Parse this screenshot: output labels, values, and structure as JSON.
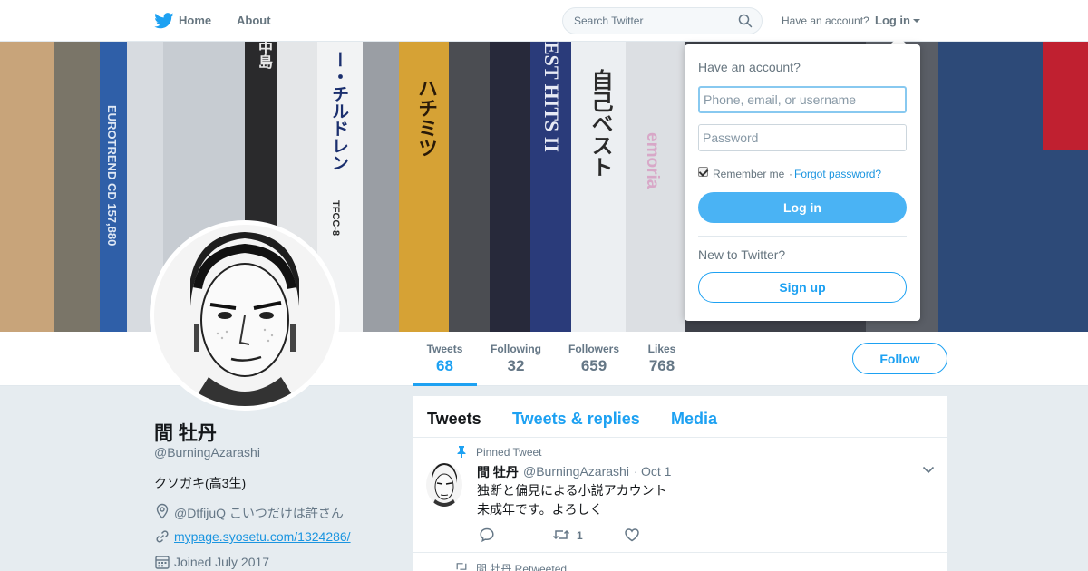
{
  "nav": {
    "home_label": "Home",
    "about_label": "About",
    "search_placeholder": "Search Twitter",
    "have_account": "Have an account?",
    "login_label": "Log in"
  },
  "banner": {
    "spine_texts": [
      "EUROTREND CD 157,880",
      "ー・チルドレン",
      "TFCC-8",
      "ハチミツ",
      "EST HITS II",
      "自己ベスト",
      "emoria",
      "中島"
    ]
  },
  "stats": [
    {
      "label": "Tweets",
      "value": "68"
    },
    {
      "label": "Following",
      "value": "32"
    },
    {
      "label": "Followers",
      "value": "659"
    },
    {
      "label": "Likes",
      "value": "768"
    }
  ],
  "follow_label": "Follow",
  "profile": {
    "name": "間 牡丹",
    "handle": "@BurningAzarashi",
    "bio": "クソガキ(高3生)",
    "location": "@DtfijuQ こいつだけは許さん",
    "url": "mypage.syosetu.com/1324286/",
    "joined": "Joined July 2017"
  },
  "timeline": {
    "tabs": [
      "Tweets",
      "Tweets & replies",
      "Media"
    ],
    "pinned_label": "Pinned Tweet",
    "tweet": {
      "name": "間 牡丹",
      "handle": "@BurningAzarashi",
      "separator": "·",
      "date": "Oct 1",
      "lines": [
        "独断と偏見による小説アカウント",
        "未成年です。よろしく"
      ],
      "retweet_count": "1"
    },
    "retweeted_label": "間 牡丹 Retweeted"
  },
  "login_dropdown": {
    "title": "Have an account?",
    "username_placeholder": "Phone, email, or username",
    "password_placeholder": "Password",
    "remember_label": "Remember me",
    "separator": "·",
    "forgot_label": "Forgot password?",
    "login_button": "Log in",
    "new_label": "New to Twitter?",
    "signup_button": "Sign up"
  },
  "colors": {
    "accent": "#1da1f2",
    "login_button": "#4ab3f4",
    "link": "#1b95e0",
    "page_bg": "#e6ecf0"
  }
}
